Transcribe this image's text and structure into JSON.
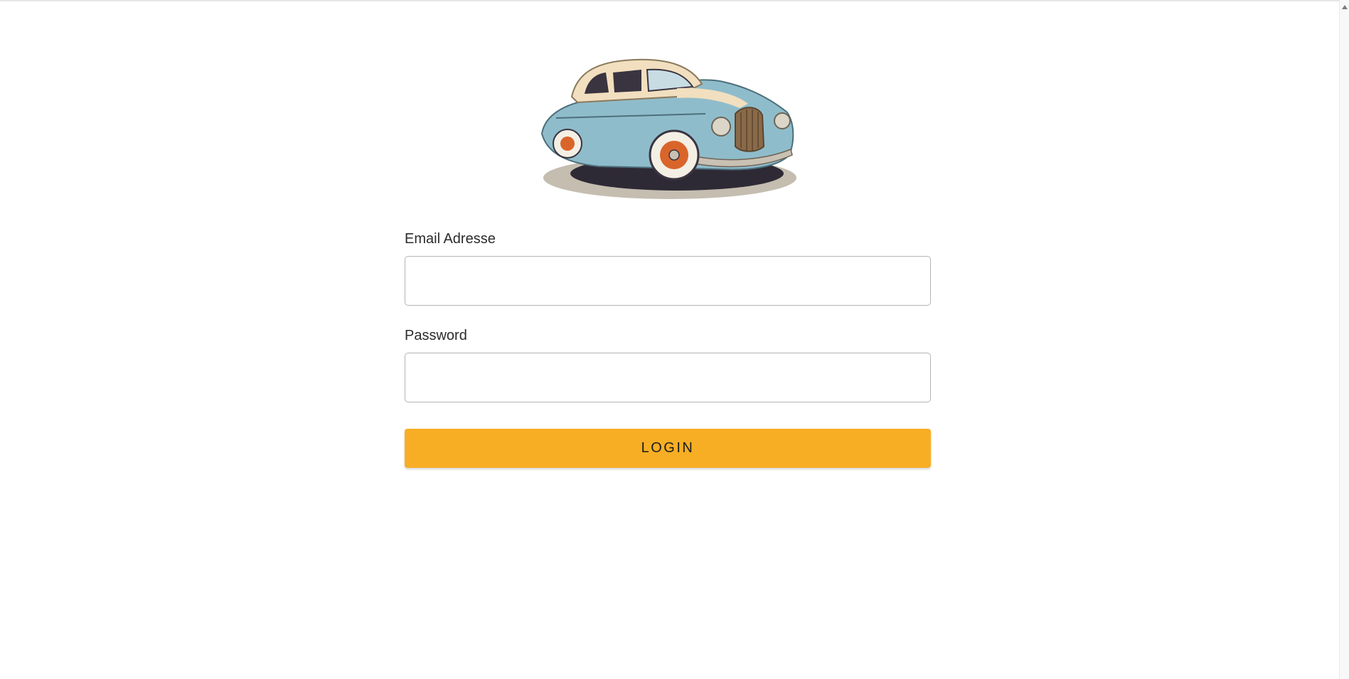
{
  "logo": {
    "icon": "vintage-car-illustration",
    "colors": {
      "body": "#8fbccb",
      "roof": "#f1dfbf",
      "chrome": "#c9c1b3",
      "wheel_accent": "#d9652a",
      "shadow": "#2e2a35"
    }
  },
  "form": {
    "email": {
      "label": "Email Adresse",
      "value": "",
      "placeholder": ""
    },
    "password": {
      "label": "Password",
      "value": "",
      "placeholder": ""
    },
    "login_label": "LOGIN"
  },
  "colors": {
    "accent": "#f7ae25",
    "input_border": "#b4b4b4",
    "label_text": "#2b2b2b"
  }
}
